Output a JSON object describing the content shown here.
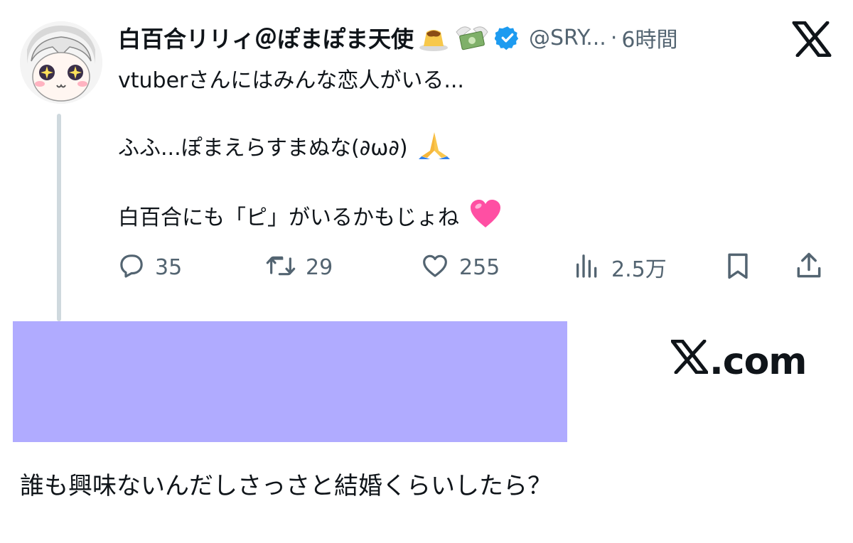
{
  "tweet": {
    "display_name": "白百合リリィ＠ぽまぽま天使",
    "handle": "@SRY...",
    "separator": "·",
    "time": "6時間",
    "verified": true,
    "name_icons": [
      "pudding-emoji",
      "money-with-wings-emoji",
      "verified-badge-icon"
    ],
    "text_lines": [
      "vtuberさんにはみんな恋人がいる...",
      "ふふ...ぽまえらすまぬな(∂ω∂)",
      "白百合にも「ピ」がいるかもじょね"
    ],
    "text_icons": [
      "folded-hands-emoji",
      "pink-heart-emoji"
    ]
  },
  "actions": {
    "reply_count": "35",
    "retweet_count": "29",
    "like_count": "255",
    "views_count": "2.5万"
  },
  "brand": {
    "site_label": ".com",
    "logo_icon": "x-logo-icon"
  },
  "caption": "誰も興味ないんだしさっさと結婚くらいしたら？",
  "colors": {
    "text": "#0f1419",
    "secondary": "#536471",
    "verified": "#1d9bf0",
    "redaction": "#b0abff",
    "thread_line": "#cfd9de"
  }
}
